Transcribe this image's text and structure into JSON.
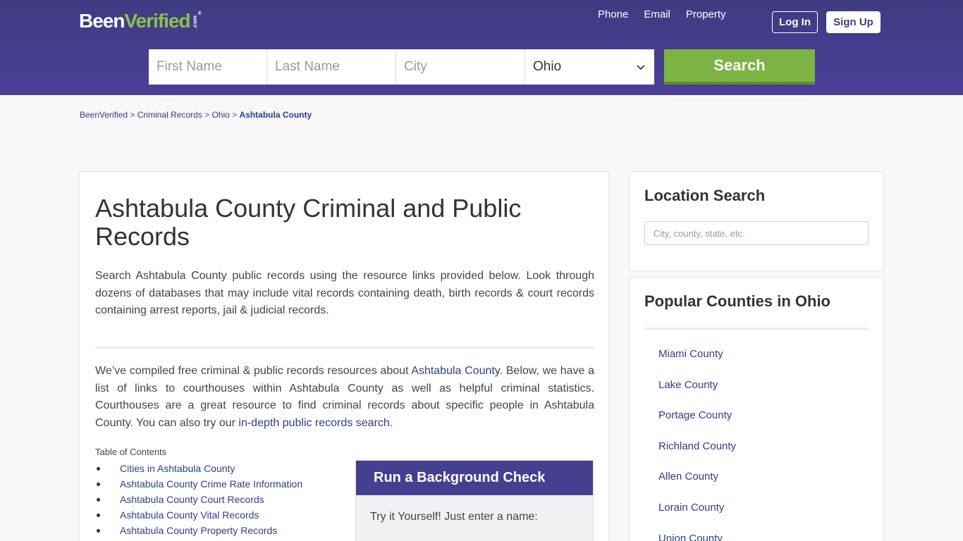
{
  "header": {
    "logo": {
      "been": "Been",
      "verified": "Verified",
      "dotcom": ".com",
      "reg": "®"
    },
    "nav": [
      "Phone",
      "Email",
      "Property"
    ],
    "login_label": "Log In",
    "signup_label": "Sign Up",
    "search": {
      "first_placeholder": "First Name",
      "last_placeholder": "Last Name",
      "city_placeholder": "City",
      "state_value": "Ohio",
      "button_label": "Search"
    }
  },
  "breadcrumb": {
    "items": [
      "BeenVerified",
      "Criminal Records",
      "Ohio"
    ],
    "separator": ">",
    "current": "Ashtabula County"
  },
  "main": {
    "title": "Ashtabula County Criminal and Public Records",
    "intro": "Search Ashtabula County public records using the resource links provided below. Look through dozens of databases that may include vital records containing death, birth records & court records containing arrest reports, jail & judicial records.",
    "body_part1": "We’ve compiled free criminal & public records resources about ",
    "body_link1": "Ashtabula County",
    "body_part2": ". Below, we have a list of links to courthouses within Ashtabula County as well as helpful criminal statistics. Courthouses are a great resource to find criminal records about specific people in Ashtabula County. You can also try our ",
    "body_link2": "in-depth public records search",
    "body_part3": ".",
    "toc_label": "Table of Contents",
    "toc": [
      "Cities in Ashtabula County",
      "Ashtabula County Crime Rate Information",
      "Ashtabula County Court Records",
      "Ashtabula County Vital Records",
      "Ashtabula County Property Records"
    ],
    "bg_check": {
      "title": "Run a Background Check",
      "subtitle": "Try it Yourself! Just enter a name:"
    }
  },
  "sidebar": {
    "location_search": {
      "title": "Location Search",
      "placeholder": "City, county, state, etc."
    },
    "popular": {
      "title": "Popular Counties in Ohio",
      "counties": [
        "Miami County",
        "Lake County",
        "Portage County",
        "Richland County",
        "Allen County",
        "Lorain County",
        "Union County"
      ]
    }
  }
}
